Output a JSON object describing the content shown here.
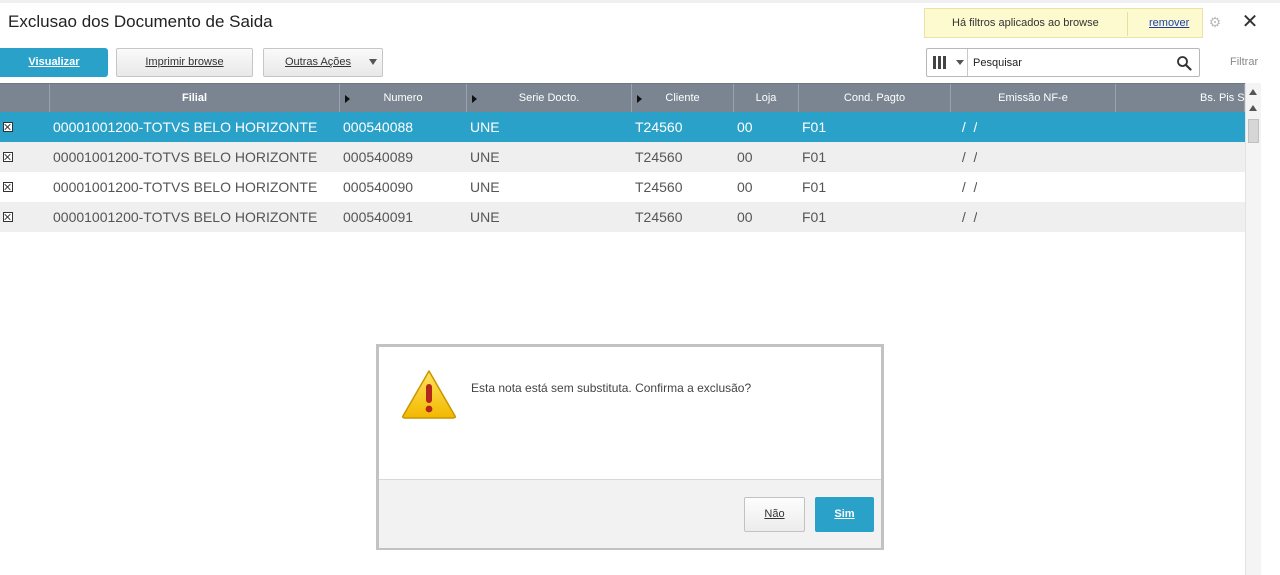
{
  "page": {
    "title": "Exclusao dos Documento de Saida"
  },
  "filter_banner": {
    "message": "Há filtros aplicados ao browse",
    "remove_label": "remover"
  },
  "toolbar": {
    "visualizar_label": "Visualizar",
    "imprimir_label": "Imprimir browse",
    "outras_acoes_label": "Outras Ações",
    "search_placeholder": "Pesquisar",
    "search_value": "Pesquisar",
    "filtrar_label": "Filtrar"
  },
  "grid": {
    "columns": [
      "",
      "Filial",
      "Numero",
      "Serie Docto.",
      "Cliente",
      "Loja",
      "Cond. Pagto",
      "Emissão NF-e",
      "Bs. Pis ST"
    ],
    "rows": [
      {
        "filial": "00001001200-TOTVS BELO HORIZONTE",
        "numero": "000540088",
        "serie": "UNE",
        "cliente": "T24560",
        "loja": "00",
        "cond": "F01",
        "emissao": " /  /",
        "selected": true
      },
      {
        "filial": "00001001200-TOTVS BELO HORIZONTE",
        "numero": "000540089",
        "serie": "UNE",
        "cliente": "T24560",
        "loja": "00",
        "cond": "F01",
        "emissao": " /  /",
        "selected": false
      },
      {
        "filial": "00001001200-TOTVS BELO HORIZONTE",
        "numero": "000540090",
        "serie": "UNE",
        "cliente": "T24560",
        "loja": "00",
        "cond": "F01",
        "emissao": " /  /",
        "selected": false
      },
      {
        "filial": "00001001200-TOTVS BELO HORIZONTE",
        "numero": "000540091",
        "serie": "UNE",
        "cliente": "T24560",
        "loja": "00",
        "cond": "F01",
        "emissao": " /  /",
        "selected": false
      }
    ]
  },
  "dialog": {
    "message": "Esta nota está sem substituta. Confirma a exclusão?",
    "no_label": "Não",
    "yes_label": "Sim"
  },
  "colors": {
    "accent": "#2aa1c9",
    "header_bg": "#7a8591",
    "banner_bg": "#fdfacf",
    "warning": "#f5c400"
  }
}
